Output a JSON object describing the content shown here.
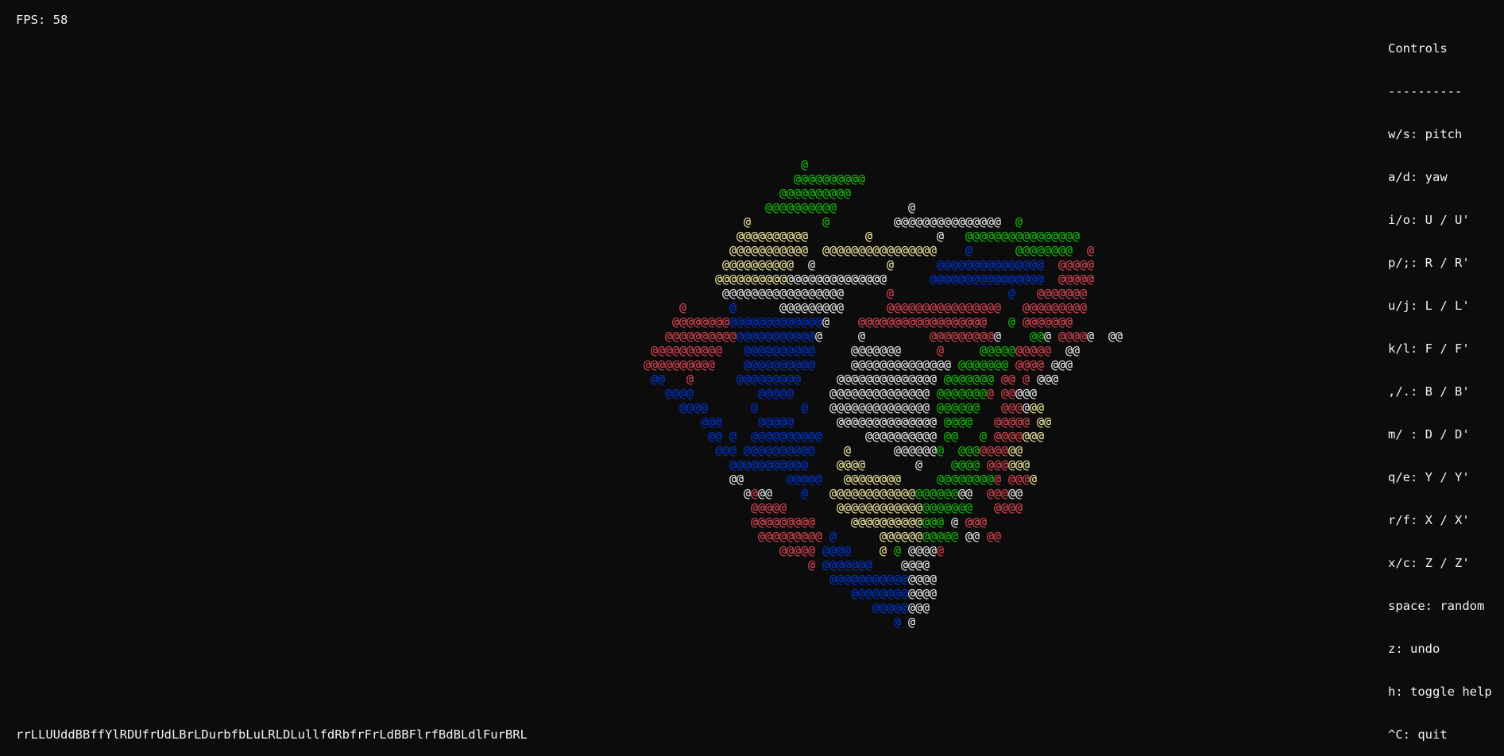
{
  "hud": {
    "fps_label": "FPS: 58"
  },
  "controls": {
    "title": "Controls",
    "separator": "----------",
    "items": [
      "w/s: pitch",
      "a/d: yaw",
      "i/o: U / U'",
      "p/;: R / R'",
      "u/j: L / L'",
      "k/l: F / F'",
      ",/.: B / B'",
      "m/ : D / D'",
      "q/e: Y / Y'",
      "r/f: X / X'",
      "x/c: Z / Z'",
      "space: random",
      "z: undo",
      "h: toggle help",
      "^C: quit"
    ]
  },
  "move_history": "rrLLUUddBBffYlRDUfrUdLBrLDurbfbLuLRLDLullfdRbfrFrLdBBFlrfBdBLdlFurBRL",
  "cube": {
    "glyph": "@",
    "palette": {
      "W": "#f2f2f2",
      "G": "#16c60c",
      "Y": "#f9f1a5",
      "B": "#0037da",
      "R": "#e74856"
    },
    "rows": [
      "                                                                                                                @",
      "                                                                                                               @@@@@@@@@@",
      "                                                                                                             @@@@@@@@@@",
      "                                                                                                           @@@@@@@@@@          @",
      "                                                                                                        @          @         @@@@@@@@@@@@@@@  @",
      "                                                                                                       @@@@@@@@@@        @         @   @@@@@@@@@@@@@@@@",
      "                                                                                                      @@@@@@@@@@@  @@@@@@@@@@@@@@@@    @      @@@@@@@@  @",
      "                                                                                                     @@@@@@@@@@  @          @      @@@@@@@@@@@@@@@  @@@@@",
      "                                                                                                    @@@@@@@@@@@@@@@@@@@@@@@@      @@@@@@@@@@@@@@@@  @@@@@",
      "                                                                                                     @@@@@@@@@@@@@@@@@      @                @   @@@@@@@",
      "                                                                                               @      @      @@@@@@@@@      @@@@@@@@@@@@@@@@   @@@@@@@@@",
      "                                                                                              @@@@@@@@@@@@@@@@@@@@@@    @@@@@@@@@@@@@@@@@@   @ @@@@@@@",
      "                                                                                             @@@@@@@@@@@@@@@@@@@@@@     @         @@@@@@@@@@    @@@ @@@@@  @@",
      "                                                                                           @@@@@@@@@@   @@@@@@@@@@     @@@@@@@     @     @@@@@@@@@@  @@",
      "                                                                                          @@@@@@@@@@    @@@@@@@@@@     @@@@@@@@@@@@@@ @@@@@@@ @@@@ @@@",
      "                                                                                           @@   @      @@@@@@@@@     @@@@@@@@@@@@@@ @@@@@@@ @@ @ @@@",
      "                                                                                             @@@@         @@@@@     @@@@@@@@@@@@@@ @@@@@@@@ @@@@@",
      "                                                                                               @@@@      @      @   @@@@@@@@@@@@@@ @@@@@@   @@@@@@",
      "                                                                                                  @@@     @@@@@      @@@@@@@@@@@@@@ @@@@   @@@@@ @@",
      "                                                                                                   @@ @  @@@@@@@@@@      @@@@@@@@@@ @@   @ @@@@@@@",
      "                                                                                                    @@@ @@@@@@@@@@    @      @@@@@@@  @@@@@@@@@",
      "                                                                                                      @@@@@@@@@@@    @@@@       @    @@@@ @@@@@@",
      "                                                                                                      @@      @@@@@   @@@@@@@@     @@@@@@@@@ @@@@",
      "                                                                                                        @@@@    @   @@@@@@@@@@@@@@@@@@@@  @@@@@",
      "                                                                                                         @@@@@       @@@@@@@@@@@@@@@@@@@   @@@@",
      "                                                                                                         @@@@@@@@@     @@@@@@@@@@@@@ @ @@@",
      "                                                                                                          @@@@@@@@@ @      @@@@@@@@@@@ @@ @@",
      "                                                                                                             @@@@@ @@@@    @ @ @@@@@",
      "                                                                                                                 @ @@@@@@@    @@@@",
      "                                                                                                                    @@@@@@@@@@@@@@@",
      "                                                                                                                       @@@@@@@@@@@@",
      "                                                                                                                          @@@@@@@@",
      "                                                                                                                             @ @"
    ],
    "colors": [
      "                                                                                                                G",
      "                                                                                                               GGGGGGGGGG",
      "                                                                                                             GGGGGGGGGG",
      "                                                                                                           GGGGGGGGGG          W",
      "                                                                                                        Y          G         WWWWWWWWWWWWWWW  G",
      "                                                                                                       YYYYYYYYYY        Y         W   GGGGGGGGGGGGGGGG",
      "                                                                                                      YYYYYYYYYYY  YYYYYYYYYYYYYYYY    B      GGGGGGGG  R",
      "                                                                                                     YYYYYYYYYY  W          Y      BBBBBBBBBBBBBBB  RRRRR",
      "                                                                                                    YYYYYYYYYYWWWWWWWWWWWWWW      BBBBBBBBBBBBBBBB  RRRRR",
      "                                                                                                     WWWWWWWWWWWWWWWWW      R                B   RRRRRRR",
      "                                                                                               R      B      WWWWWWWWW      RRRRRRRRRRRRRRRR   RRRRRRRRR",
      "                                                                                              RRRRRRRRBBBBBBBBBBBBBW    RRRRRRRRRRRRRRRRRR   G RRRRRRR",
      "                                                                                             RRRRRRRRRRBBBBBBBBBBB     W         RRRRRRRRRR    GGG RRRRR  WW",
      "                                                                                           RRRRRRRRRR   BBBBBBBBBB     WWWWWWW     R     GGGGGRRRRR  WW",
      "                                                                                          RRRRRRRRRR    BBBBBBBBBB     WWWWWWWWWWWWWW GGGGGGG RRRR WWW",
      "                                                                                           BB   R      BBBBBBBBB     WWWWWWWWWWWWWW GGGGGGG RR R WWW",
      "                                                                                             BBBB         BBBBB     WWWWWWWWWWWWWW GGGGGGGR RRWWW",
      "                                                                                               BBBB      B      B   WWWWWWWWWWWWWW GGGGGG   RRRWYY",
      "                                                                                                  BBB     BBBBB      WWWWWWWWWWWWWW GGGG   RRRRR YY",
      "                                                                                                   BB B  BBBBBBBBBB      WWWWWWWWWW GG   G RRRRYYY",
      "                                                                                                    BBB BBBBBBBBBB    Y      WWWWWWG  GGGRRRRYYY",
      "                                                                                                      BBBBBBBBBBB    YYYY       W    GGGG RRRYYY",
      "                                                                                                      WW      BBBBB   YYYYYYYY     GGGGGGGGR RRRY",
      "                                                                                                        WRWW    B   YYYYYYYYYYYYGGGGGG  RRRRR",
      "                                                                                                         RRRRR       YYYYYYYYYYYYGGGGGGG   RRRR",
      "                                                                                                         RRRRRRRRR     YYYYYYYYYYGGG W RRR",
      "                                                                                                          RRRRRRRRR B      YYYYYYGGGGG WW RR",
      "                                                                                                             RRRRR BBBB    Y G WWWWR",
      "                                                                                                                 R BBBBBBB    WWWW",
      "                                                                                                                    BBBBBBBBBBBWWWW",
      "                                                                                                                       BBBBBBBBWWWW",
      "                                                                                                                          BBBBBWWW",
      "                                                                                                                             B W"
    ]
  }
}
